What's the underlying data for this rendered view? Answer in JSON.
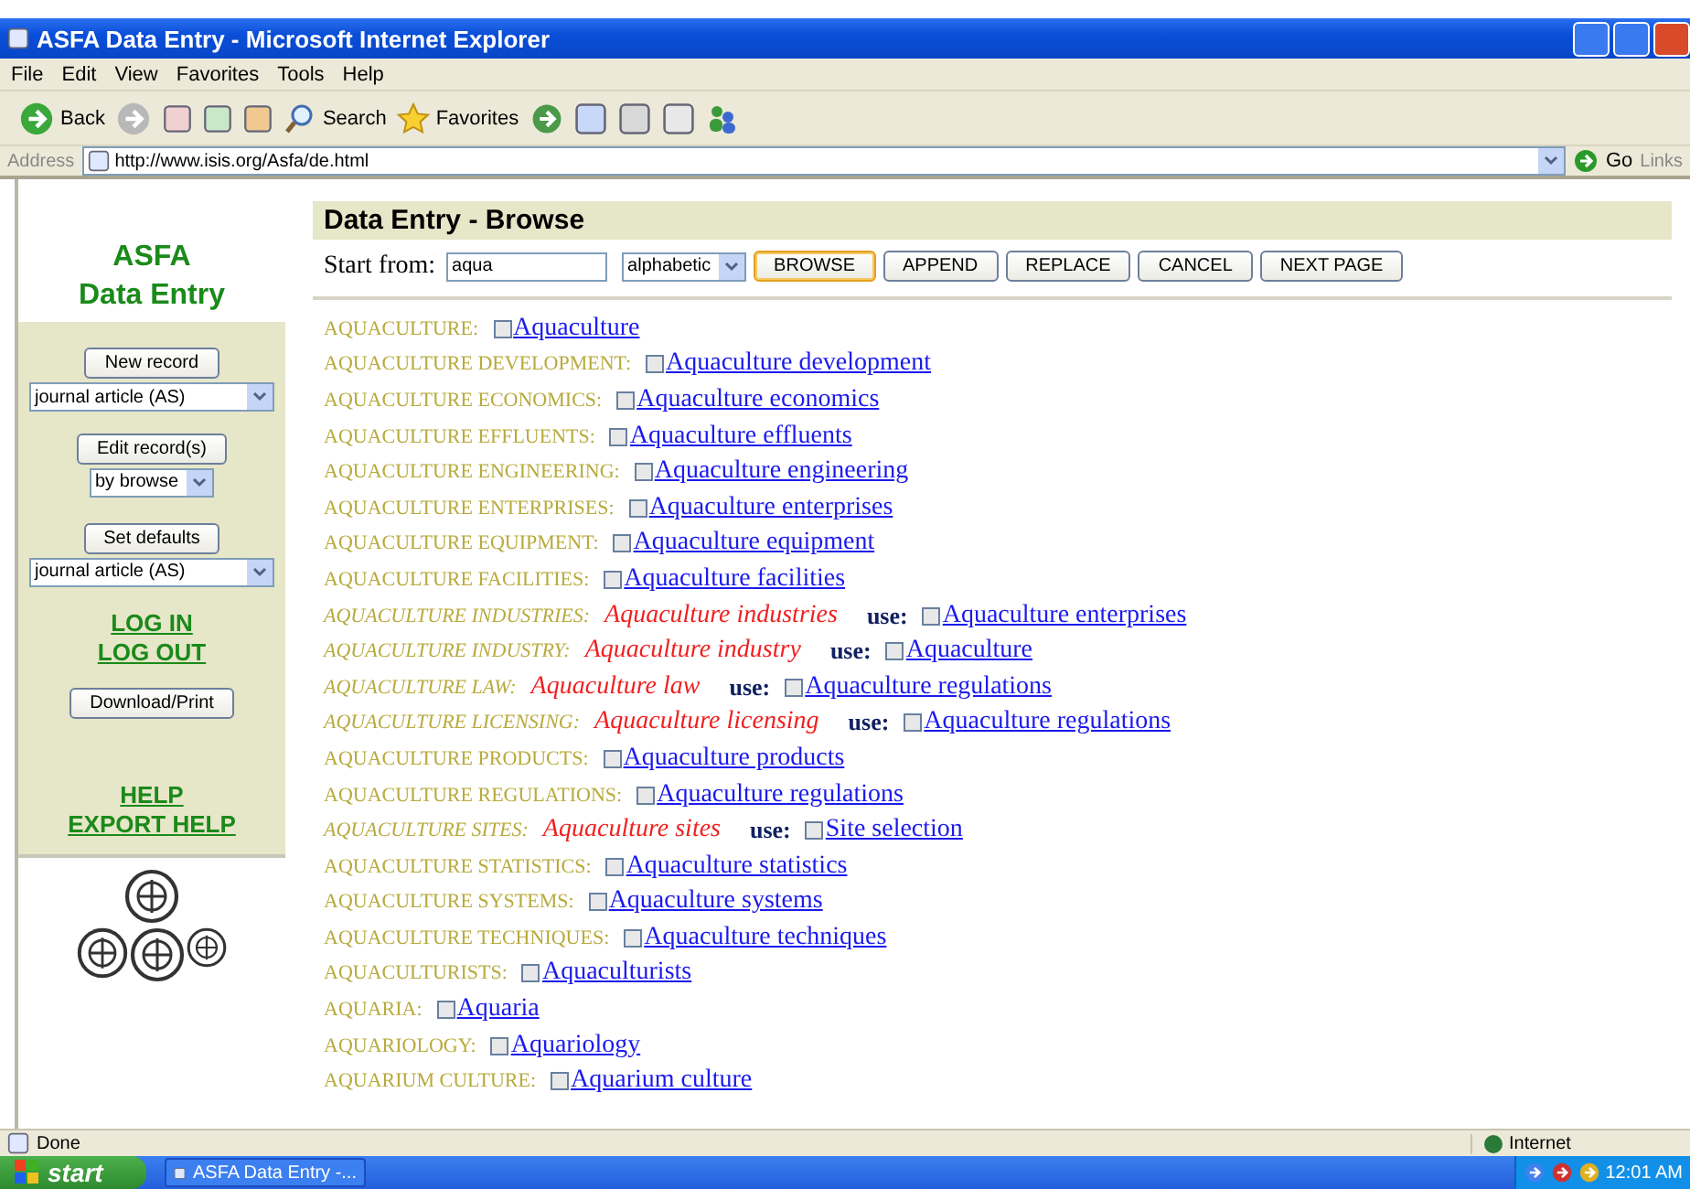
{
  "window": {
    "title": "ASFA Data Entry - Microsoft Internet Explorer"
  },
  "menu": [
    "File",
    "Edit",
    "View",
    "Favorites",
    "Tools",
    "Help"
  ],
  "toolbar": {
    "back": "Back",
    "search": "Search",
    "favorites": "Favorites"
  },
  "address": {
    "label": "Address",
    "url": "http://www.isis.org/Asfa/de.html",
    "go": "Go",
    "links": "Links"
  },
  "sidebar": {
    "title": [
      "ASFA",
      "Data Entry"
    ],
    "new_record": {
      "button": "New record",
      "select": "journal article (AS)"
    },
    "edit_records": {
      "button": "Edit record(s)",
      "select": "by browse"
    },
    "set_defaults": {
      "button": "Set defaults",
      "select": "journal article (AS)"
    },
    "auth_links": [
      "LOG IN",
      "LOG OUT"
    ],
    "download": "Download/Print",
    "help_links": [
      "HELP",
      "EXPORT HELP"
    ]
  },
  "page_title": "Data Entry - Browse",
  "form": {
    "label": "Start from:",
    "value": "aqua",
    "order": "alphabetic",
    "buttons": [
      {
        "label": "BROWSE",
        "selected": true
      },
      {
        "label": "APPEND",
        "selected": false
      },
      {
        "label": "REPLACE",
        "selected": false
      },
      {
        "label": "CANCEL",
        "selected": false
      },
      {
        "label": "NEXT PAGE",
        "selected": false
      }
    ]
  },
  "entries": [
    {
      "kind": "term",
      "heading": "AQUACULTURE:",
      "link": "Aquaculture",
      "checked": false
    },
    {
      "kind": "term",
      "heading": "AQUACULTURE DEVELOPMENT:",
      "link": "Aquaculture development",
      "checked": false
    },
    {
      "kind": "term",
      "heading": "AQUACULTURE ECONOMICS:",
      "link": "Aquaculture economics",
      "checked": false
    },
    {
      "kind": "term",
      "heading": "AQUACULTURE EFFLUENTS:",
      "link": "Aquaculture effluents",
      "checked": false
    },
    {
      "kind": "term",
      "heading": "AQUACULTURE ENGINEERING:",
      "link": "Aquaculture engineering",
      "checked": false
    },
    {
      "kind": "term",
      "heading": "AQUACULTURE ENTERPRISES:",
      "link": "Aquaculture enterprises",
      "checked": false
    },
    {
      "kind": "term",
      "heading": "AQUACULTURE EQUIPMENT:",
      "link": "Aquaculture equipment",
      "checked": false
    },
    {
      "kind": "term",
      "heading": "AQUACULTURE FACILITIES:",
      "link": "Aquaculture facilities",
      "checked": false
    },
    {
      "kind": "use",
      "heading": "AQUACULTURE INDUSTRIES:",
      "term": "Aquaculture industries",
      "use": "use:",
      "link": "Aquaculture enterprises",
      "checked": false
    },
    {
      "kind": "use",
      "heading": "AQUACULTURE INDUSTRY:",
      "term": "Aquaculture industry",
      "use": "use:",
      "link": "Aquaculture",
      "checked": false
    },
    {
      "kind": "use",
      "heading": "AQUACULTURE LAW:",
      "term": "Aquaculture law",
      "use": "use:",
      "link": "Aquaculture regulations",
      "checked": false
    },
    {
      "kind": "use",
      "heading": "AQUACULTURE LICENSING:",
      "term": "Aquaculture licensing",
      "use": "use:",
      "link": "Aquaculture regulations",
      "checked": false
    },
    {
      "kind": "term",
      "heading": "AQUACULTURE PRODUCTS:",
      "link": "Aquaculture products",
      "checked": false
    },
    {
      "kind": "term",
      "heading": "AQUACULTURE REGULATIONS:",
      "link": "Aquaculture regulations",
      "checked": false
    },
    {
      "kind": "use",
      "heading": "AQUACULTURE SITES:",
      "term": "Aquaculture sites",
      "use": "use:",
      "link": "Site selection",
      "checked": false
    },
    {
      "kind": "term",
      "heading": "AQUACULTURE STATISTICS:",
      "link": "Aquaculture statistics",
      "checked": false
    },
    {
      "kind": "term",
      "heading": "AQUACULTURE SYSTEMS:",
      "link": "Aquaculture systems",
      "checked": false
    },
    {
      "kind": "term",
      "heading": "AQUACULTURE TECHNIQUES:",
      "link": "Aquaculture techniques",
      "checked": false
    },
    {
      "kind": "term",
      "heading": "AQUACULTURISTS:",
      "link": "Aquaculturists",
      "checked": false
    },
    {
      "kind": "term",
      "heading": "AQUARIA:",
      "link": "Aquaria",
      "checked": false
    },
    {
      "kind": "term",
      "heading": "AQUARIOLOGY:",
      "link": "Aquariology",
      "checked": false
    },
    {
      "kind": "term",
      "heading": "AQUARIUM CULTURE:",
      "link": "Aquarium culture",
      "checked": false
    }
  ],
  "status_bar": {
    "text": "Done",
    "zone": "Internet"
  },
  "taskbar": {
    "start": "start",
    "task": "ASFA Data Entry -...",
    "clock": "12:01 AM"
  }
}
